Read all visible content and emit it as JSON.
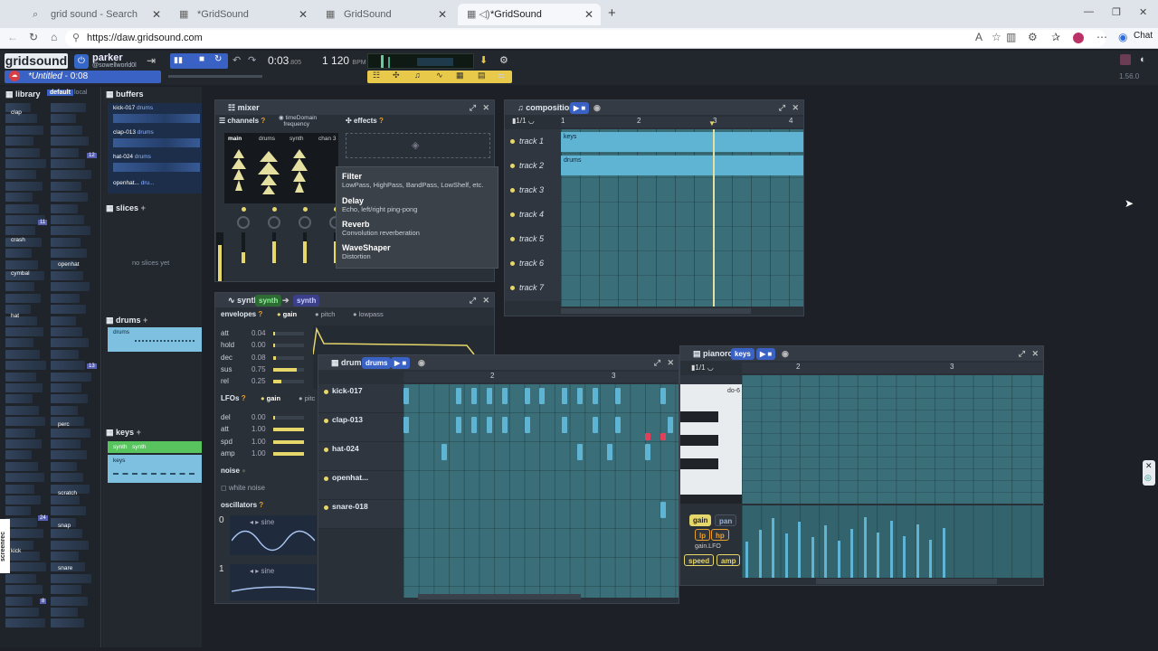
{
  "browser": {
    "tabs": [
      {
        "label": "grid sound - Search"
      },
      {
        "label": "*GridSound"
      },
      {
        "label": "GridSound"
      },
      {
        "label": "*GridSound"
      }
    ],
    "url": "https://daw.gridsound.com",
    "chat": "Chat"
  },
  "app": {
    "logo": "gridsound",
    "user": "parker",
    "handle": "@sowellworld0l",
    "time": "0:03",
    "time_ms": ".805",
    "bpm_beats": "1",
    "bpm": "120",
    "bpm_unit": "BPM",
    "title": "*Untitled",
    "title_time": "- 0:08",
    "version": "1.56.0"
  },
  "library": {
    "title": "library",
    "tab_default": "default",
    "tab_local": "local",
    "items": [
      "clap",
      "crash",
      "cymbal",
      "openhat",
      "hat",
      "perc",
      "scratch",
      "snap",
      "kick",
      "snare"
    ],
    "badges": [
      "12",
      "11",
      "13",
      "12",
      "24",
      "8"
    ],
    "recorder": "screenrec"
  },
  "buffers": {
    "title": "buffers",
    "items": [
      {
        "name": "kick-017",
        "tag": "drums"
      },
      {
        "name": "clap-013",
        "tag": "drums"
      },
      {
        "name": "hat-024",
        "tag": "drums"
      },
      {
        "name": "openhat...",
        "tag": "dru..."
      }
    ]
  },
  "slices": {
    "title": "slices",
    "empty": "no slices yet"
  },
  "drums_panel": {
    "title": "drums",
    "item": "drums"
  },
  "keys_panel": {
    "title": "keys",
    "synth": "synth",
    "synth2": "synth",
    "item": "keys"
  },
  "mixer": {
    "title": "mixer",
    "channels": "channels",
    "timedomain": "timeDomain",
    "frequency": "frequency",
    "effects": "effects",
    "chan_tabs": [
      "main",
      "drums",
      "synth",
      "chan 3"
    ],
    "fx_menu": [
      {
        "name": "Filter",
        "desc": "LowPass, HighPass, BandPass, LowShelf, etc."
      },
      {
        "name": "Delay",
        "desc": "Echo, left/right ping-pong"
      },
      {
        "name": "Reverb",
        "desc": "Convolution reverberation"
      },
      {
        "name": "WaveShaper",
        "desc": "Distortion"
      }
    ]
  },
  "composition": {
    "title": "composition",
    "sig": "1/1",
    "ticks": [
      "1",
      "2",
      "3",
      "4"
    ],
    "tracks": [
      "track 1",
      "track 2",
      "track 3",
      "track 4",
      "track 5",
      "track 6",
      "track 7"
    ],
    "blocks": [
      "keys",
      "drums"
    ]
  },
  "synth": {
    "title": "synth",
    "tag": "synth",
    "tag2": "synth",
    "envelopes": "envelopes",
    "env_tabs": [
      "gain",
      "pitch",
      "lowpass"
    ],
    "env_rows": [
      {
        "k": "att",
        "v": "0.04"
      },
      {
        "k": "hold",
        "v": "0.00"
      },
      {
        "k": "dec",
        "v": "0.08"
      },
      {
        "k": "sus",
        "v": "0.75"
      },
      {
        "k": "rel",
        "v": "0.25"
      }
    ],
    "lfos": "LFOs",
    "lfo_tabs": [
      "gain",
      "pitc"
    ],
    "lfo_rows": [
      {
        "k": "del",
        "v": "0.00"
      },
      {
        "k": "att",
        "v": "1.00"
      },
      {
        "k": "spd",
        "v": "1.00"
      },
      {
        "k": "amp",
        "v": "1.00"
      }
    ],
    "noise": "noise",
    "white_noise": "white noise",
    "oscillators": "oscillators",
    "osc": [
      {
        "idx": "0",
        "wave": "sine"
      },
      {
        "idx": "1",
        "wave": "sine"
      }
    ]
  },
  "drums": {
    "title": "drums",
    "tag": "drums",
    "ticks": [
      "2",
      "3"
    ],
    "rows": [
      "kick-017",
      "clap-013",
      "hat-024",
      "openhat...",
      "snare-018"
    ]
  },
  "pianoroll": {
    "title": "pianoroll",
    "tag": "keys",
    "sig": "1/1",
    "ticks": [
      "2",
      "3"
    ],
    "key_label": "do-6",
    "buttons": [
      "gain",
      "pan",
      "lp",
      "hp",
      "gain.LFO",
      "speed",
      "amp"
    ]
  }
}
